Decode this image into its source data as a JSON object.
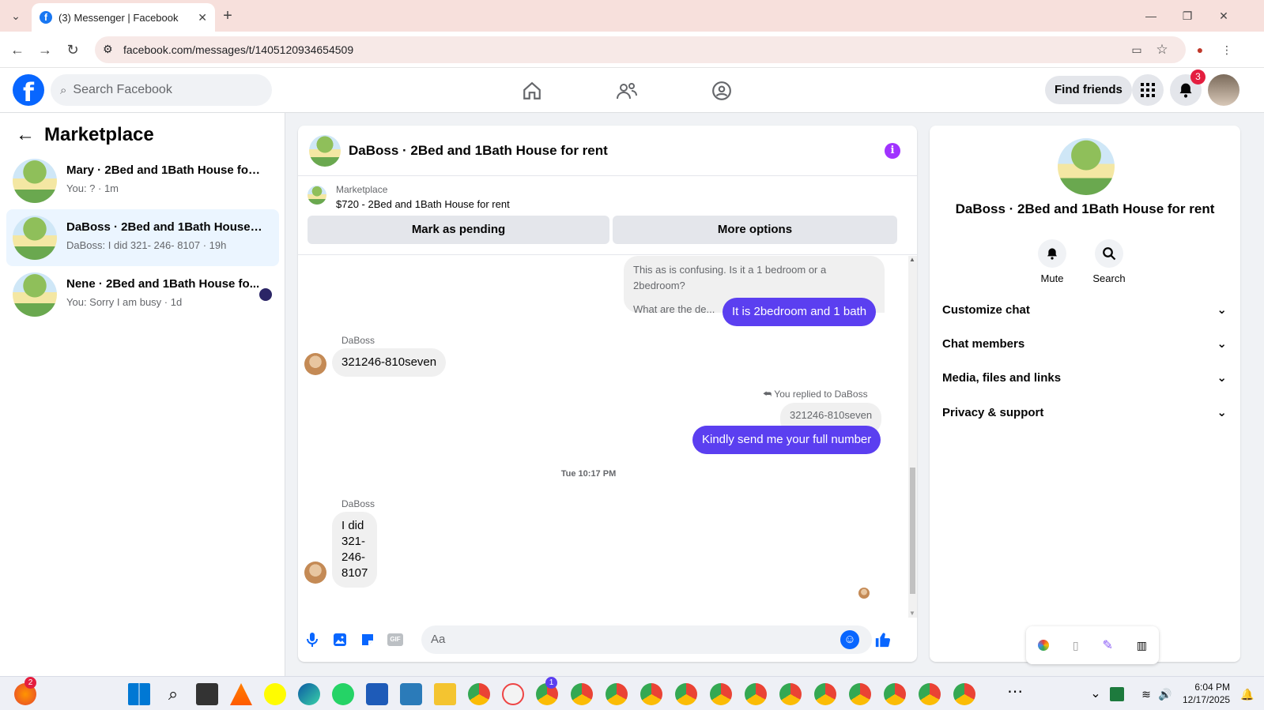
{
  "browser": {
    "tab_title": "(3) Messenger | Facebook",
    "url": "facebook.com/messages/t/1405120934654509"
  },
  "fbnav": {
    "search_placeholder": "Search Facebook",
    "find_friends": "Find friends",
    "notification_count": "3"
  },
  "sidebar": {
    "title": "Marketplace",
    "conversations": [
      {
        "name": "Mary · 2Bed and 1Bath House for r...",
        "snippet": "You: ? · 1m"
      },
      {
        "name": "DaBoss · 2Bed and 1Bath House fo...",
        "snippet": "DaBoss: I did 321- 246- 8107 · 19h"
      },
      {
        "name": "Nene · 2Bed and 1Bath House fo...",
        "snippet": "You: Sorry I am busy · 1d"
      }
    ]
  },
  "chat": {
    "title": "DaBoss · 2Bed and 1Bath House for rent",
    "listing": {
      "label": "Marketplace",
      "price_title": "$720 - 2Bed and 1Bath House for rent",
      "mark_pending": "Mark as pending",
      "more_options": "More options"
    },
    "messages": {
      "quoted_1a": "This as is confusing. Is it a 1 bedroom or a 2bedroom?",
      "quoted_1b": "What are the de...",
      "out_1": "It is  2bedroom and 1 bath",
      "sender_1": "DaBoss",
      "in_1": "321246-810seven",
      "reply_label": "You replied to DaBoss",
      "quoted_2": "321246-810seven",
      "out_2": "Kindly send me your full number",
      "timestamp": "Tue 10:17 PM",
      "sender_2": "DaBoss",
      "in_2_lines": [
        "I did",
        "321-",
        "246-",
        "8107"
      ]
    },
    "composer_placeholder": "Aa"
  },
  "rpanel": {
    "title": "DaBoss · 2Bed and 1Bath House for rent",
    "mute": "Mute",
    "search": "Search",
    "rows": [
      "Customize chat",
      "Chat members",
      "Media, files and links",
      "Privacy & support"
    ]
  },
  "taskbar": {
    "time": "6:04 PM",
    "date": "12/17/2025",
    "firefox_badge": "2",
    "chrome_badge": "1"
  },
  "colors": {
    "brand": "#0866ff",
    "outgoing_bubble": "#5b3ff0",
    "info_accent": "#a033ff"
  }
}
